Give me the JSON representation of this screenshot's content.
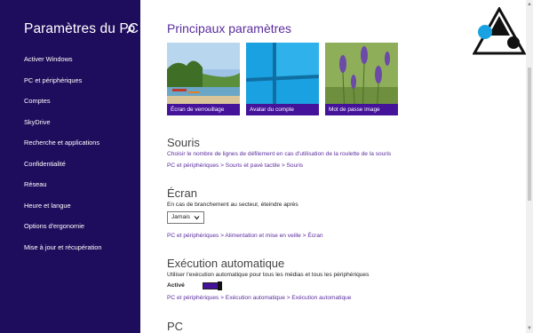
{
  "sidebar": {
    "title": "Paramètres du PC",
    "items": [
      {
        "label": "Activer Windows"
      },
      {
        "label": "PC et périphériques"
      },
      {
        "label": "Comptes"
      },
      {
        "label": "SkyDrive"
      },
      {
        "label": "Recherche et applications"
      },
      {
        "label": "Confidentialité"
      },
      {
        "label": "Réseau"
      },
      {
        "label": "Heure et langue"
      },
      {
        "label": "Options d'ergonomie"
      },
      {
        "label": "Mise à jour et récupération"
      }
    ],
    "search_icon": "search-icon",
    "background": "#1e0d5c"
  },
  "main": {
    "title": "Principaux paramètres",
    "tiles": [
      {
        "caption": "Écran de verrouillage"
      },
      {
        "caption": "Avatar du compte"
      },
      {
        "caption": "Mot de passe image"
      }
    ],
    "souris": {
      "heading": "Souris",
      "link": "Choisir le nombre de lignes de défilement en cas d'utilisation de la roulette de la souris",
      "path": "PC et périphériques > Souris et pavé tactile > Souris"
    },
    "ecran": {
      "heading": "Écran",
      "text": "En cas de branchement au secteur, éteindre après",
      "select_value": "Jamais",
      "path": "PC et périphériques > Alimentation et mise en veille > Écran"
    },
    "execution": {
      "heading": "Exécution automatique",
      "text": "Utiliser l'exécution automatique pour tous les médias et tous les périphériques",
      "toggle_label": "Activé",
      "path": "PC et périphériques > Exécution automatique > Exécution automatique"
    },
    "pc": {
      "heading": "PC"
    },
    "accent": "#5b2c9e",
    "tile_caption_bg": "#44139a"
  }
}
